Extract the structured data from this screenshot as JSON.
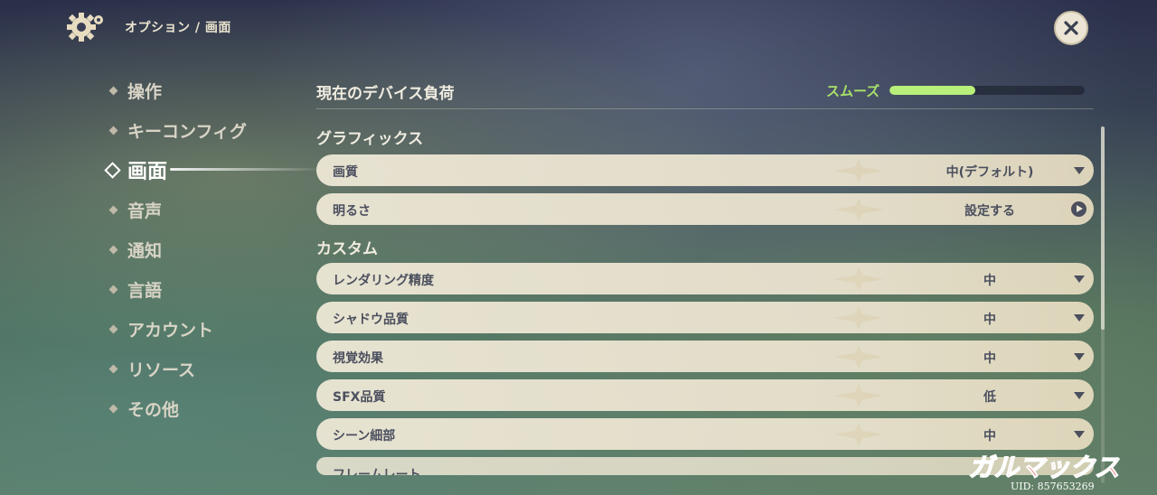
{
  "header": {
    "breadcrumb": "オプション / 画面",
    "gear_icon": "gear-icon",
    "close_icon": "close-icon"
  },
  "sidebar": {
    "items": [
      {
        "label": "操作",
        "active": false
      },
      {
        "label": "キーコンフィグ",
        "active": false
      },
      {
        "label": "画面",
        "active": true
      },
      {
        "label": "音声",
        "active": false
      },
      {
        "label": "通知",
        "active": false
      },
      {
        "label": "言語",
        "active": false
      },
      {
        "label": "アカウント",
        "active": false
      },
      {
        "label": "リソース",
        "active": false
      },
      {
        "label": "その他",
        "active": false
      }
    ]
  },
  "main": {
    "device_load": {
      "title": "現在のデバイス負荷",
      "status": "スムーズ",
      "level": 0.44,
      "status_color": "#a8e06a"
    },
    "graphics": {
      "heading": "グラフィックス",
      "rows": [
        {
          "label": "画質",
          "value": "中(デフォルト)",
          "control": "dropdown"
        },
        {
          "label": "明るさ",
          "value": "設定する",
          "control": "go"
        }
      ]
    },
    "custom": {
      "heading": "カスタム",
      "rows": [
        {
          "label": "レンダリング精度",
          "value": "中",
          "control": "dropdown"
        },
        {
          "label": "シャドウ品質",
          "value": "中",
          "control": "dropdown"
        },
        {
          "label": "視覚効果",
          "value": "中",
          "control": "dropdown"
        },
        {
          "label": "SFX品質",
          "value": "低",
          "control": "dropdown"
        },
        {
          "label": "シーン細部",
          "value": "中",
          "control": "dropdown"
        },
        {
          "label": "フレームレート",
          "value": "",
          "control": "dropdown"
        }
      ]
    }
  },
  "overlay": {
    "watermark": "ガルマックス",
    "uid": "UID: 857653269"
  }
}
